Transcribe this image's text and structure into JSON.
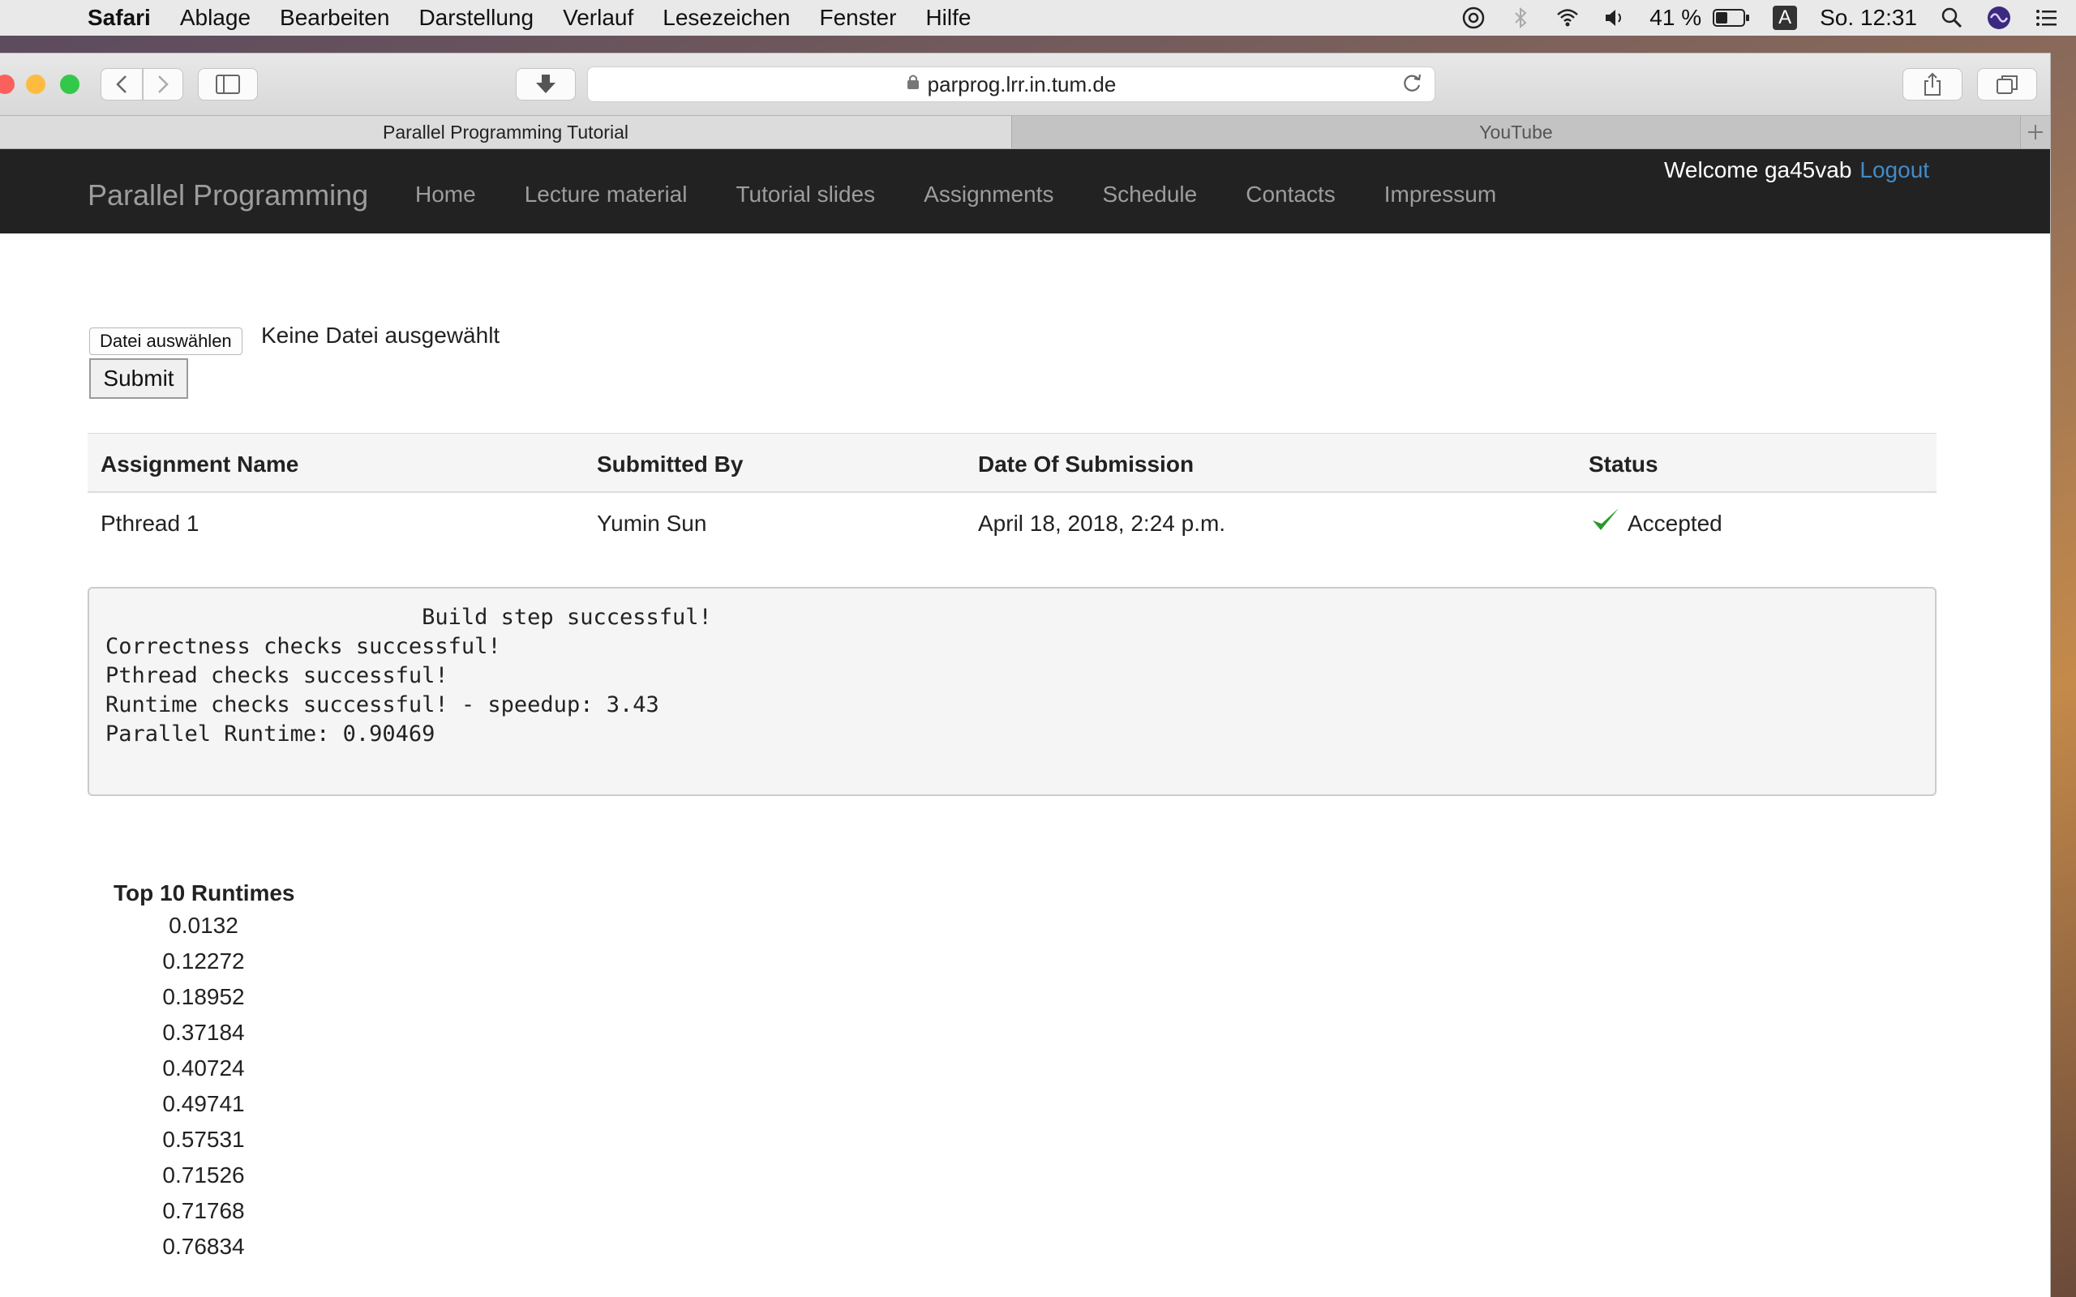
{
  "menubar": {
    "apple": "",
    "app": "Safari",
    "items": [
      "Ablage",
      "Bearbeiten",
      "Darstellung",
      "Verlauf",
      "Lesezeichen",
      "Fenster",
      "Hilfe"
    ],
    "battery": "41 %",
    "input_source": "A",
    "clock": "So. 12:31",
    "icons": [
      "password-icon",
      "bluetooth-icon",
      "wifi-icon",
      "volume-icon",
      "battery-icon",
      "spotlight-icon",
      "siri-icon",
      "notification-center-icon"
    ]
  },
  "browser": {
    "url": "parprog.lrr.in.tum.de",
    "tabs": [
      {
        "label": "Parallel Programming Tutorial",
        "active": true
      },
      {
        "label": "YouTube",
        "active": false
      }
    ]
  },
  "navbar": {
    "brand": "Parallel Programming",
    "links": [
      "Home",
      "Lecture material",
      "Tutorial slides",
      "Assignments",
      "Schedule",
      "Contacts",
      "Impressum"
    ],
    "welcome": "Welcome ga45vab",
    "logout": "Logout"
  },
  "upload": {
    "choose_file_label": "Datei auswählen",
    "file_status": "Keine Datei ausgewählt",
    "submit_label": "Submit"
  },
  "submissions": {
    "headers": [
      "Assignment Name",
      "Submitted By",
      "Date Of Submission",
      "Status"
    ],
    "rows": [
      {
        "assignment": "Pthread 1",
        "submitted_by": "Yumin Sun",
        "date": "April 18, 2018, 2:24 p.m.",
        "status": "Accepted",
        "status_icon": "checkmark-icon",
        "status_color": "#2a9a2a"
      }
    ]
  },
  "log": {
    "lines": [
      "                        Build step successful!",
      "Correctness checks successful!",
      "Pthread checks successful!",
      "Runtime checks successful! - speedup: 3.43",
      "Parallel Runtime: 0.90469"
    ]
  },
  "runtimes": {
    "title": "Top 10 Runtimes",
    "values": [
      "0.0132",
      "0.12272",
      "0.18952",
      "0.37184",
      "0.40724",
      "0.49741",
      "0.57531",
      "0.71526",
      "0.71768",
      "0.76834"
    ]
  },
  "colors": {
    "navbar_bg": "#222222",
    "link_blue": "#428bca",
    "accepted_green": "#2a9a2a"
  }
}
